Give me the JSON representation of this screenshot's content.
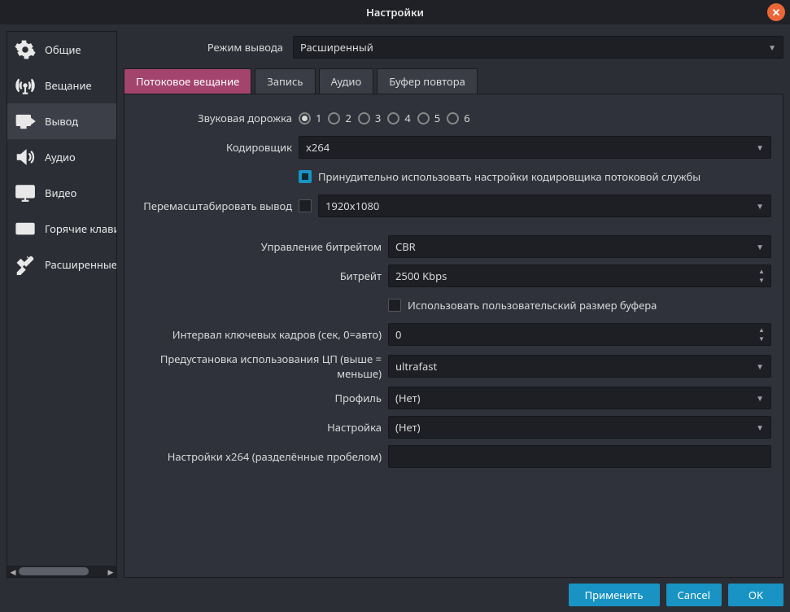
{
  "window": {
    "title": "Настройки"
  },
  "sidebar": {
    "items": [
      {
        "id": "general",
        "label": "Общие"
      },
      {
        "id": "stream",
        "label": "Вещание"
      },
      {
        "id": "output",
        "label": "Вывод"
      },
      {
        "id": "audio",
        "label": "Аудио"
      },
      {
        "id": "video",
        "label": "Видео"
      },
      {
        "id": "hotkeys",
        "label": "Горячие клавиши"
      },
      {
        "id": "advanced",
        "label": "Расширенные"
      }
    ],
    "active": 2
  },
  "output_mode": {
    "label": "Режим вывода",
    "value": "Расширенный"
  },
  "tabs": [
    {
      "id": "streaming",
      "label": "Потоковое вещание"
    },
    {
      "id": "recording",
      "label": "Запись"
    },
    {
      "id": "audio",
      "label": "Аудио"
    },
    {
      "id": "replay",
      "label": "Буфер повтора"
    }
  ],
  "active_tab": 0,
  "form": {
    "audio_track": {
      "label": "Звуковая дорожка",
      "options": [
        "1",
        "2",
        "3",
        "4",
        "5",
        "6"
      ],
      "selected": 0
    },
    "encoder": {
      "label": "Кодировщик",
      "value": "x264"
    },
    "enforce": {
      "label": "Принудительно использовать настройки кодировщика потоковой службы",
      "checked": true
    },
    "rescale": {
      "label": "Перемасштабировать вывод",
      "checked": false,
      "value": "1920x1080"
    },
    "rate_control": {
      "label": "Управление битрейтом",
      "value": "CBR"
    },
    "bitrate": {
      "label": "Битрейт",
      "value": "2500 Kbps"
    },
    "custom_buffer": {
      "label": "Использовать пользовательский размер буфера",
      "checked": false
    },
    "keyint": {
      "label": "Интервал ключевых кадров (сек, 0=авто)",
      "value": "0"
    },
    "cpu_preset": {
      "label": "Предустановка использования ЦП (выше = меньше)",
      "value": "ultrafast"
    },
    "profile": {
      "label": "Профиль",
      "value": "(Нет)"
    },
    "tune": {
      "label": "Настройка",
      "value": "(Нет)"
    },
    "x264opts": {
      "label": "Настройки x264 (разделённые пробелом)",
      "value": ""
    }
  },
  "footer": {
    "apply": "Применить",
    "cancel": "Cancel",
    "ok": "OK"
  }
}
